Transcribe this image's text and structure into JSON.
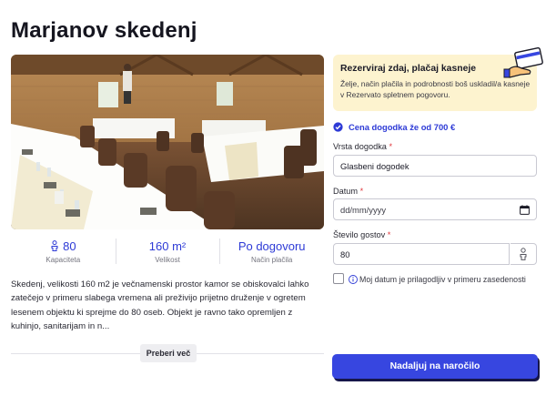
{
  "venue": {
    "title": "Marjanov skedenj",
    "stats": [
      {
        "value": "80",
        "label": "Kapaciteta",
        "icon": "person-icon"
      },
      {
        "value": "160 m²",
        "label": "Velikost"
      },
      {
        "value": "Po dogovoru",
        "label": "Način plačila"
      }
    ],
    "description": "Skedenj, velikosti 160 m2 je večnamenski prostor kamor se obiskovalci lahko zatečejo v primeru slabega vremena ali preživijo prijetno druženje v ogretem lesenem objektu ki sprejme do 80 oseb. Objekt je ravno tako opremljen z kuhinjo, sanitarijam in n...",
    "read_more": "Preberi več"
  },
  "booking": {
    "promo_title": "Rezerviraj zdaj, plačaj kasneje",
    "promo_text": "Želje, način plačila in podrobnosti boš uskladil/a kasneje v Rezervato spletnem pogovoru.",
    "price": "Cena dogodka že od 700 €",
    "event_type_label": "Vrsta dogodka",
    "event_type_value": "Glasbeni dogodek",
    "date_label": "Datum",
    "date_placeholder": "dd/mm/yyyy",
    "guests_label": "Število gostov",
    "guests_value": "80",
    "required_mark": "*",
    "flexible_date_text": "Moj datum je prilagodljiv v primeru zasedenosti",
    "cta": "Nadaljuj na naročilo"
  },
  "colors": {
    "accent": "#3746e0",
    "link": "#2d3ad6",
    "promo_bg": "#fdf3cf",
    "required": "#e0393e"
  }
}
